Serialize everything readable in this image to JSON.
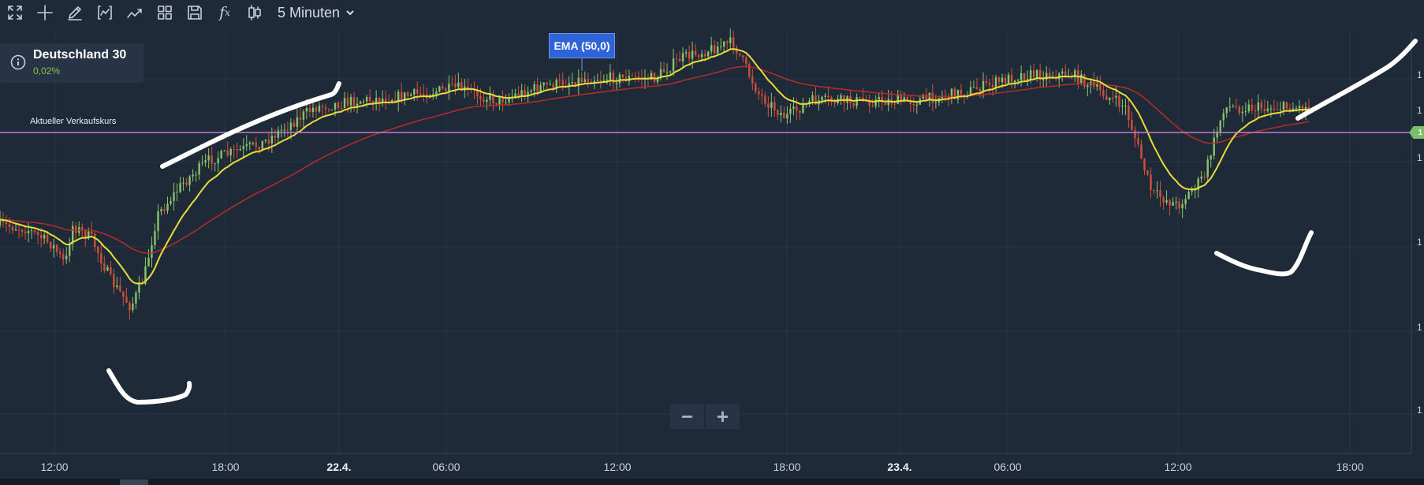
{
  "toolbar": {
    "icons": [
      "fullscreen-icon",
      "crosshair-icon",
      "pencil-icon",
      "indicator-icon",
      "trend-icon",
      "layout-grid-icon",
      "save-icon",
      "function-icon",
      "candlestick-icon"
    ],
    "function_glyph": "f",
    "timeframe": "5 Minuten"
  },
  "instrument": {
    "name": "Deutschland 30",
    "change": "0,02%"
  },
  "price_line": {
    "label": "Aktueller Verkaufskurs",
    "flag_text": "1",
    "color": "#c27bd1"
  },
  "ema_tag": "EMA (50,0)",
  "zoom": {
    "minus": "−",
    "plus": "+"
  },
  "x_axis": {
    "ticks": [
      {
        "label": "12:00",
        "bold": false
      },
      {
        "label": "18:00",
        "bold": false
      },
      {
        "label": "22.4.",
        "bold": true
      },
      {
        "label": "06:00",
        "bold": false
      },
      {
        "label": "12:00",
        "bold": false
      },
      {
        "label": "18:00",
        "bold": false
      },
      {
        "label": "23.4.",
        "bold": true
      },
      {
        "label": "06:00",
        "bold": false
      },
      {
        "label": "12:00",
        "bold": false
      },
      {
        "label": "18:00",
        "bold": false
      }
    ]
  },
  "y_axis": {
    "tick_labels": [
      "1",
      "1",
      "1",
      "1",
      "1",
      "1"
    ]
  },
  "colors": {
    "background": "#1f2a38",
    "grid": "#2a3646",
    "up_candle": "#8ac46a",
    "down_candle": "#d0503a",
    "ema_fast": "#e8dc3a",
    "ema_slow": "#b92a2a",
    "annotation": "#ffffff"
  },
  "chart_data": {
    "type": "candlestick",
    "timeframe": "5 Minuten",
    "x_categories": [
      "12:00",
      "18:00",
      "22.4.",
      "06:00",
      "12:00",
      "18:00",
      "23.4.",
      "06:00",
      "12:00",
      "18:00"
    ],
    "close_path_relative": [
      [
        0.0,
        0.58
      ],
      [
        0.02,
        0.59
      ],
      [
        0.04,
        0.64
      ],
      [
        0.05,
        0.7
      ],
      [
        0.055,
        0.58
      ],
      [
        0.07,
        0.62
      ],
      [
        0.085,
        0.75
      ],
      [
        0.1,
        0.83
      ],
      [
        0.11,
        0.74
      ],
      [
        0.12,
        0.55
      ],
      [
        0.14,
        0.45
      ],
      [
        0.16,
        0.38
      ],
      [
        0.2,
        0.33
      ],
      [
        0.24,
        0.22
      ],
      [
        0.27,
        0.2
      ],
      [
        0.3,
        0.19
      ],
      [
        0.35,
        0.16
      ],
      [
        0.38,
        0.2
      ],
      [
        0.41,
        0.16
      ],
      [
        0.45,
        0.13
      ],
      [
        0.5,
        0.13
      ],
      [
        0.52,
        0.07
      ],
      [
        0.56,
        0.02
      ],
      [
        0.58,
        0.18
      ],
      [
        0.6,
        0.25
      ],
      [
        0.62,
        0.2
      ],
      [
        0.66,
        0.2
      ],
      [
        0.7,
        0.2
      ],
      [
        0.74,
        0.17
      ],
      [
        0.78,
        0.12
      ],
      [
        0.82,
        0.12
      ],
      [
        0.86,
        0.22
      ],
      [
        0.88,
        0.48
      ],
      [
        0.9,
        0.52
      ],
      [
        0.92,
        0.43
      ],
      [
        0.935,
        0.22
      ]
    ],
    "indicators": [
      {
        "name": "EMA (50,0)",
        "color": "#e8dc3a"
      },
      {
        "name": "",
        "color": "#b92a2a"
      }
    ],
    "current_price_label": "Aktueller Verkaufskurs",
    "grid": true
  }
}
